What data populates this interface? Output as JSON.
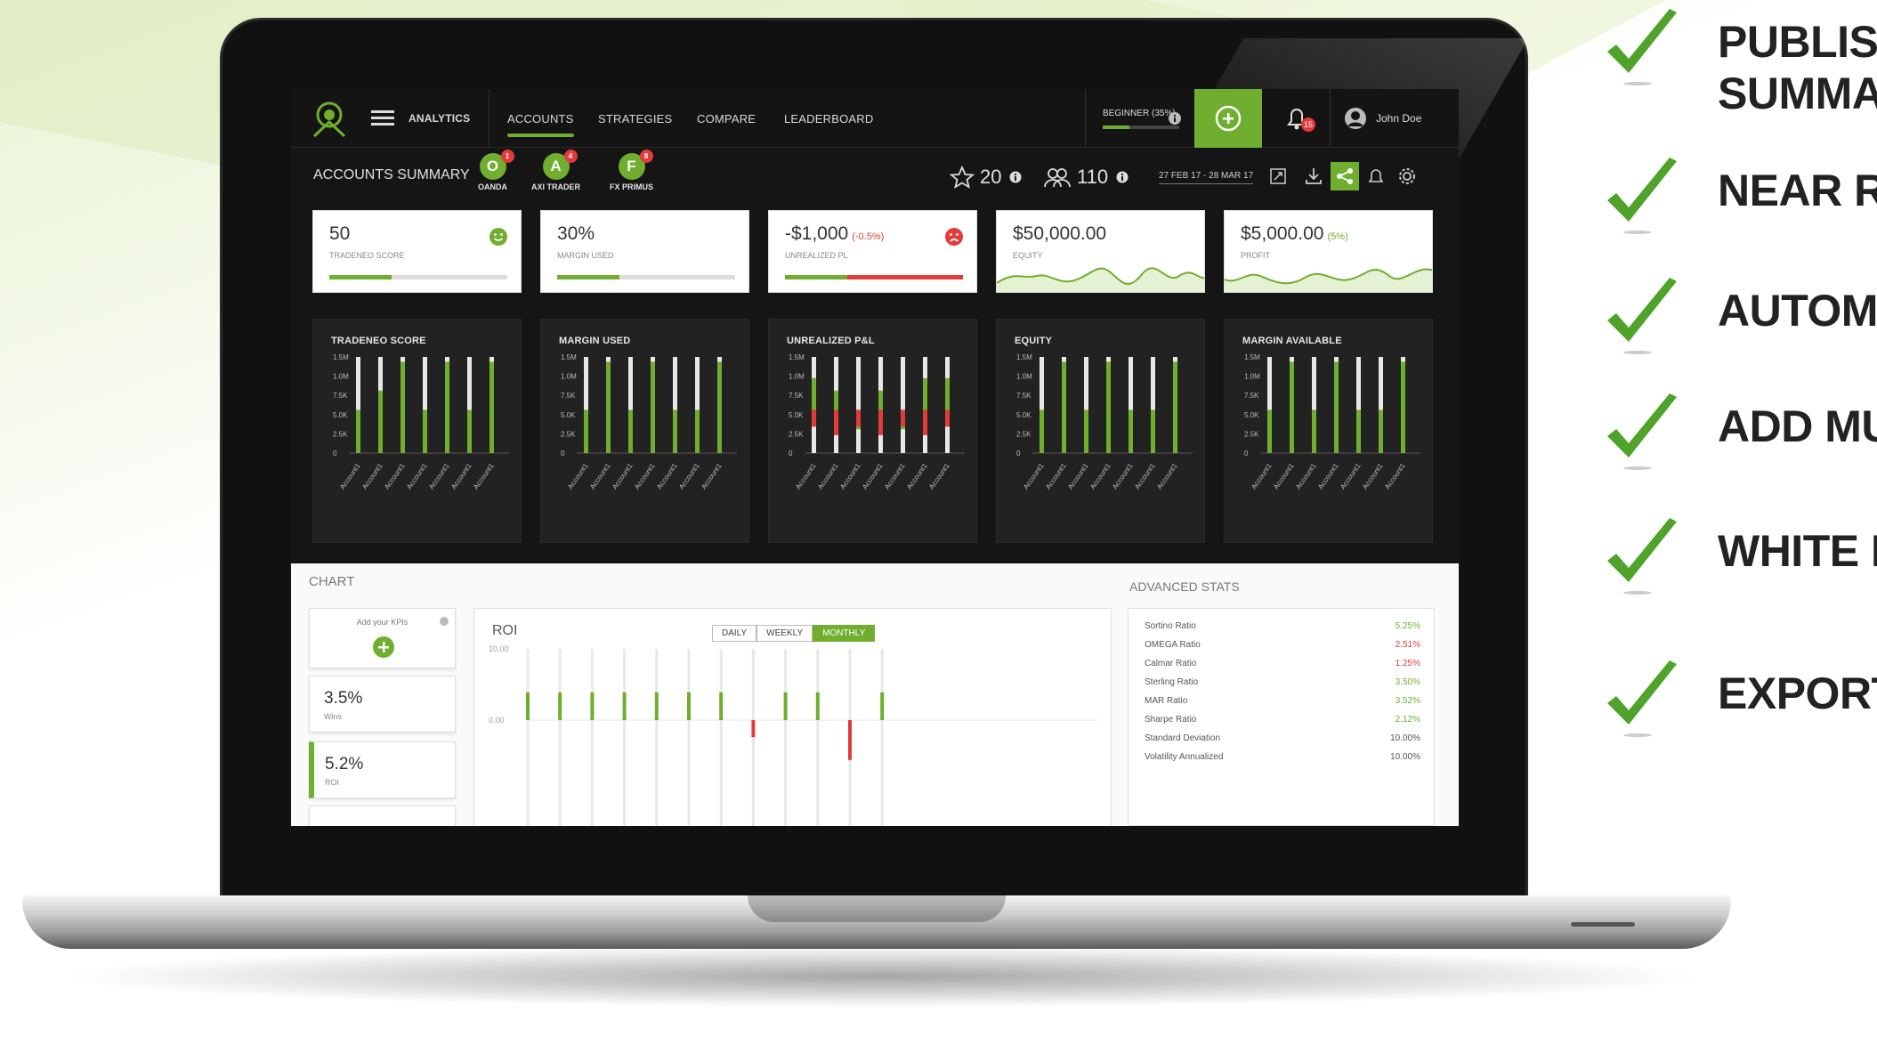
{
  "nav": {
    "analytics_label": "ANALYTICS",
    "tabs": [
      "ACCOUNTS",
      "STRATEGIES",
      "COMPARE",
      "LEADERBOARD"
    ],
    "level_label": "BEGINNER (35%)",
    "level_progress": 0.35,
    "notification_count": "15",
    "user_name": "John Doe"
  },
  "summary": {
    "title": "ACCOUNTS SUMMARY",
    "accounts": [
      {
        "letter": "O",
        "name": "OANDA",
        "badge": "1"
      },
      {
        "letter": "A",
        "name": "AXI TRADER",
        "badge": "4"
      },
      {
        "letter": "F",
        "name": "FX PRIMUS",
        "badge": "8"
      }
    ],
    "stars": "20",
    "followers": "110",
    "date_range": "27 FEB 17 - 28 MAR 17"
  },
  "kpis": [
    {
      "value": "50",
      "sub": "TRADENEO SCORE",
      "progress": 0.35,
      "mood": "happy"
    },
    {
      "value": "30%",
      "sub": "MARGIN USED",
      "progress": 0.35
    },
    {
      "value": "-$1,000",
      "delta": "(-0.5%)",
      "sub": "UNREALIZED PL",
      "progress": 0.35,
      "mood": "sad"
    },
    {
      "value": "$50,000.00",
      "sub": "EQUITY"
    },
    {
      "value": "$5,000.00",
      "delta": "(5%)",
      "sub": "PROFIT"
    }
  ],
  "colors": {
    "accent": "#6fae2e",
    "negative": "#e23b3b",
    "dark": "#151515"
  },
  "panel_y_ticks": [
    "1.5M",
    "1.0M",
    "7.5K",
    "5.0K",
    "2.5K",
    "0"
  ],
  "panel_x_label": "Account1",
  "panels": [
    {
      "title": "TRADENEO SCORE",
      "bars": [
        0.45,
        0.65,
        0.95,
        0.45,
        0.95,
        0.45,
        0.95
      ],
      "negative": false
    },
    {
      "title": "MARGIN USED",
      "bars": [
        0.45,
        0.95,
        0.45,
        0.95,
        0.45,
        0.45,
        0.95
      ],
      "negative": false
    },
    {
      "title": "UNREALIZED P&L",
      "bars": [
        0.78,
        0.65,
        0.45,
        0.65,
        0.45,
        0.78,
        0.78
      ],
      "negative": true
    },
    {
      "title": "EQUITY",
      "bars": [
        0.45,
        0.95,
        0.45,
        0.95,
        0.45,
        0.45,
        0.95
      ],
      "negative": false
    },
    {
      "title": "MARGIN AVAILABLE",
      "bars": [
        0.45,
        0.95,
        0.45,
        0.95,
        0.45,
        0.45,
        0.95
      ],
      "negative": false
    }
  ],
  "chart_section": {
    "title": "CHART",
    "add_kpis": "Add your KPIs",
    "kpi_items": [
      {
        "value": "3.5%",
        "label": "Wins"
      },
      {
        "value": "5.2%",
        "label": "ROI"
      }
    ],
    "roi_title": "ROI",
    "ranges": [
      "DAILY",
      "WEEKLY",
      "MONTHLY"
    ],
    "active_range": "MONTHLY",
    "y_top": "10.00",
    "y_zero": "0.00"
  },
  "chart_data": {
    "type": "bar",
    "title": "ROI",
    "ylabel": "",
    "y_ticks": [
      "10.00",
      "0.00"
    ],
    "values": [
      6,
      6,
      6,
      6,
      6,
      6,
      6,
      -3,
      6,
      6,
      -7,
      6
    ],
    "ylim": [
      -7,
      10
    ]
  },
  "advanced": {
    "title": "ADVANCED STATS",
    "rows": [
      {
        "name": "Sortino Ratio",
        "value": "5.25%",
        "color": "#6fae2e"
      },
      {
        "name": "OMEGA Ratio",
        "value": "2.51%",
        "color": "#e23b3b"
      },
      {
        "name": "Calmar Ratio",
        "value": "1.25%",
        "color": "#e23b3b"
      },
      {
        "name": "Sterling Ratio",
        "value": "3.50%",
        "color": "#6fae2e"
      },
      {
        "name": "MAR Ratio",
        "value": "3.52%",
        "color": "#6fae2e"
      },
      {
        "name": "Sharpe Ratio",
        "value": "2.12%",
        "color": "#6fae2e"
      },
      {
        "name": "Standard Deviation",
        "value": "10.00%",
        "color": "#555555"
      },
      {
        "name": "Volatility Annualized",
        "value": "10.00%",
        "color": "#555555"
      }
    ]
  },
  "features": [
    "PUBLISH",
    "SUMMA",
    "NEAR R",
    "AUTOM",
    "ADD MU",
    "WHITE L",
    "EXPORT"
  ]
}
